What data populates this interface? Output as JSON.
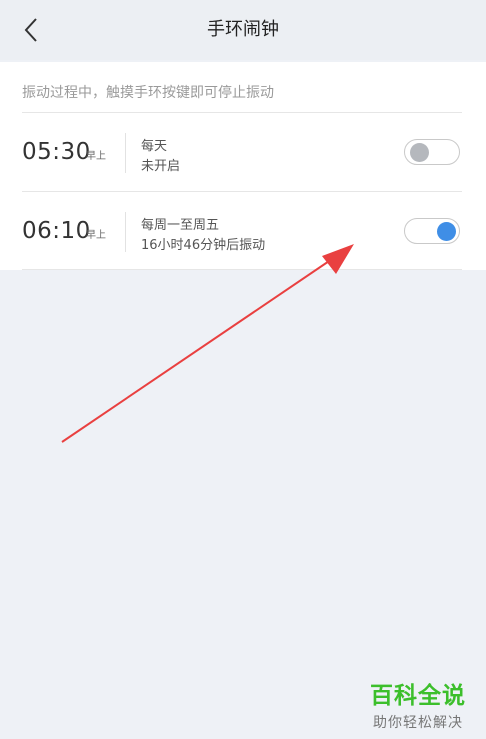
{
  "header": {
    "title": "手环闹钟",
    "back_icon": "chevron-left-icon"
  },
  "hint": "振动过程中，触摸手环按键即可停止振动",
  "alarms": [
    {
      "time": "05:30",
      "ampm": "早上",
      "repeat": "每天",
      "status": "未开启",
      "enabled": false
    },
    {
      "time": "06:10",
      "ampm": "早上",
      "repeat": "每周一至周五",
      "status": "16小时46分钟后振动",
      "enabled": true
    }
  ],
  "colors": {
    "toggle_on": "#3f8ee6",
    "toggle_off": "#b5b8bd",
    "annotation_arrow": "#e94040",
    "watermark": "#3cbf2b"
  },
  "watermark": {
    "title": "百科全说",
    "subtitle": "助你轻松解决"
  }
}
